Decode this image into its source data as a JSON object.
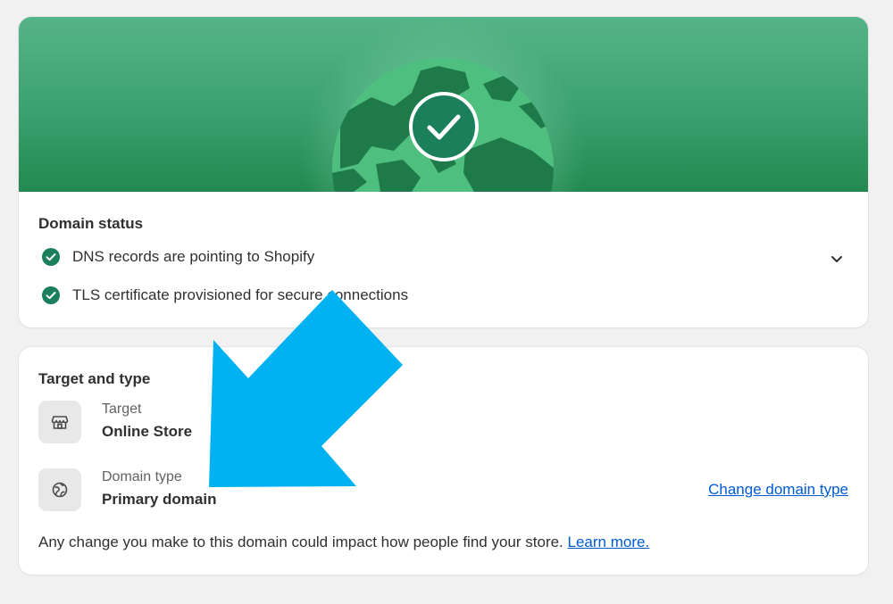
{
  "domain_status": {
    "title": "Domain status",
    "items": [
      {
        "text": "DNS records are pointing to Shopify",
        "status": "ok"
      },
      {
        "text": "TLS certificate provisioned for secure connections",
        "status": "ok"
      }
    ],
    "expand_icon": "chevron-down-icon"
  },
  "target_type": {
    "title": "Target and type",
    "target": {
      "label": "Target",
      "value": "Online Store",
      "icon": "store-icon"
    },
    "domain_type": {
      "label": "Domain type",
      "value": "Primary domain",
      "icon": "globe-icon"
    },
    "change_link": "Change domain type",
    "note": "Any change you make to this domain could impact how people find your store.",
    "learn_more": "Learn more."
  },
  "colors": {
    "hero_green": "#3ba06f",
    "success_green": "#1a7f5a",
    "link_blue": "#005bd3",
    "annotation_arrow": "#00b2f2"
  }
}
